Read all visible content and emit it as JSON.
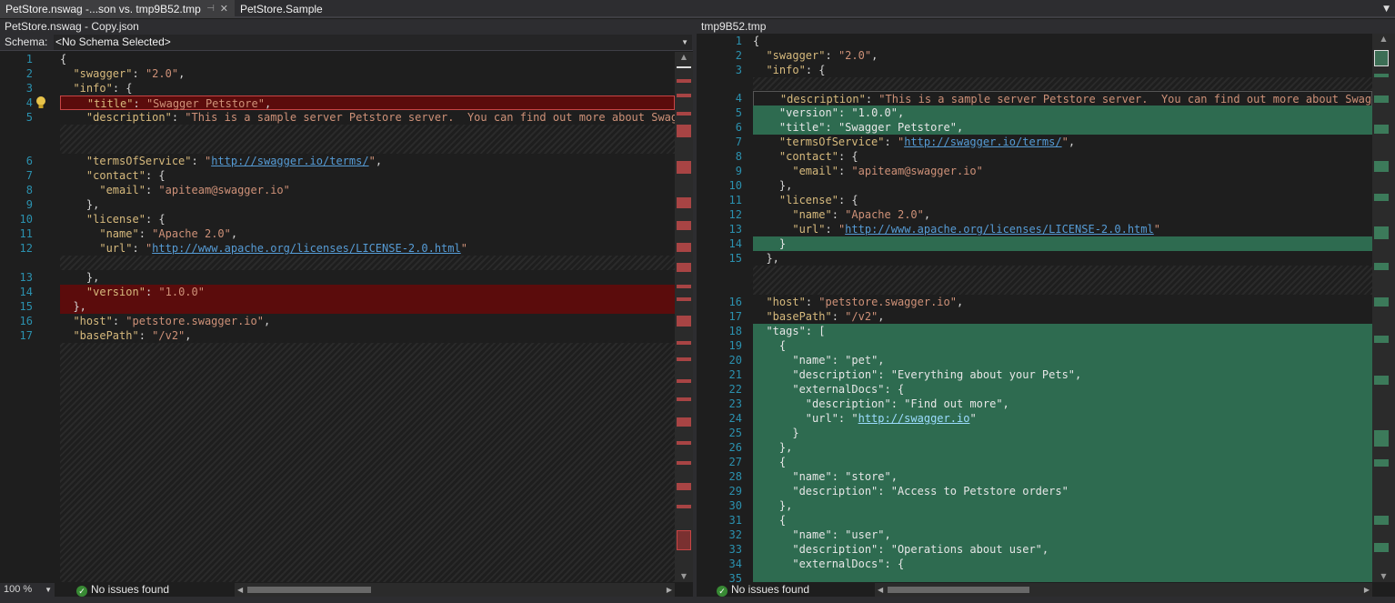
{
  "tabs": [
    {
      "label": "PetStore.nswag -...son vs. tmp9B52.tmp",
      "pin": "⊣",
      "close": "✕"
    },
    {
      "label": "PetStore.Sample"
    }
  ],
  "tab_dropdown": "▼",
  "left_pane": {
    "title": "PetStore.nswag - Copy.json",
    "schema_label": "Schema:",
    "schema_value": "<No Schema Selected>",
    "zoom": "100 %",
    "status": "No issues found"
  },
  "right_pane": {
    "title": "tmp9B52.tmp",
    "status": "No issues found"
  },
  "colors": {
    "removed": "#5b0c0c",
    "added": "#2e6b50",
    "line_number": "#2b91af"
  }
}
